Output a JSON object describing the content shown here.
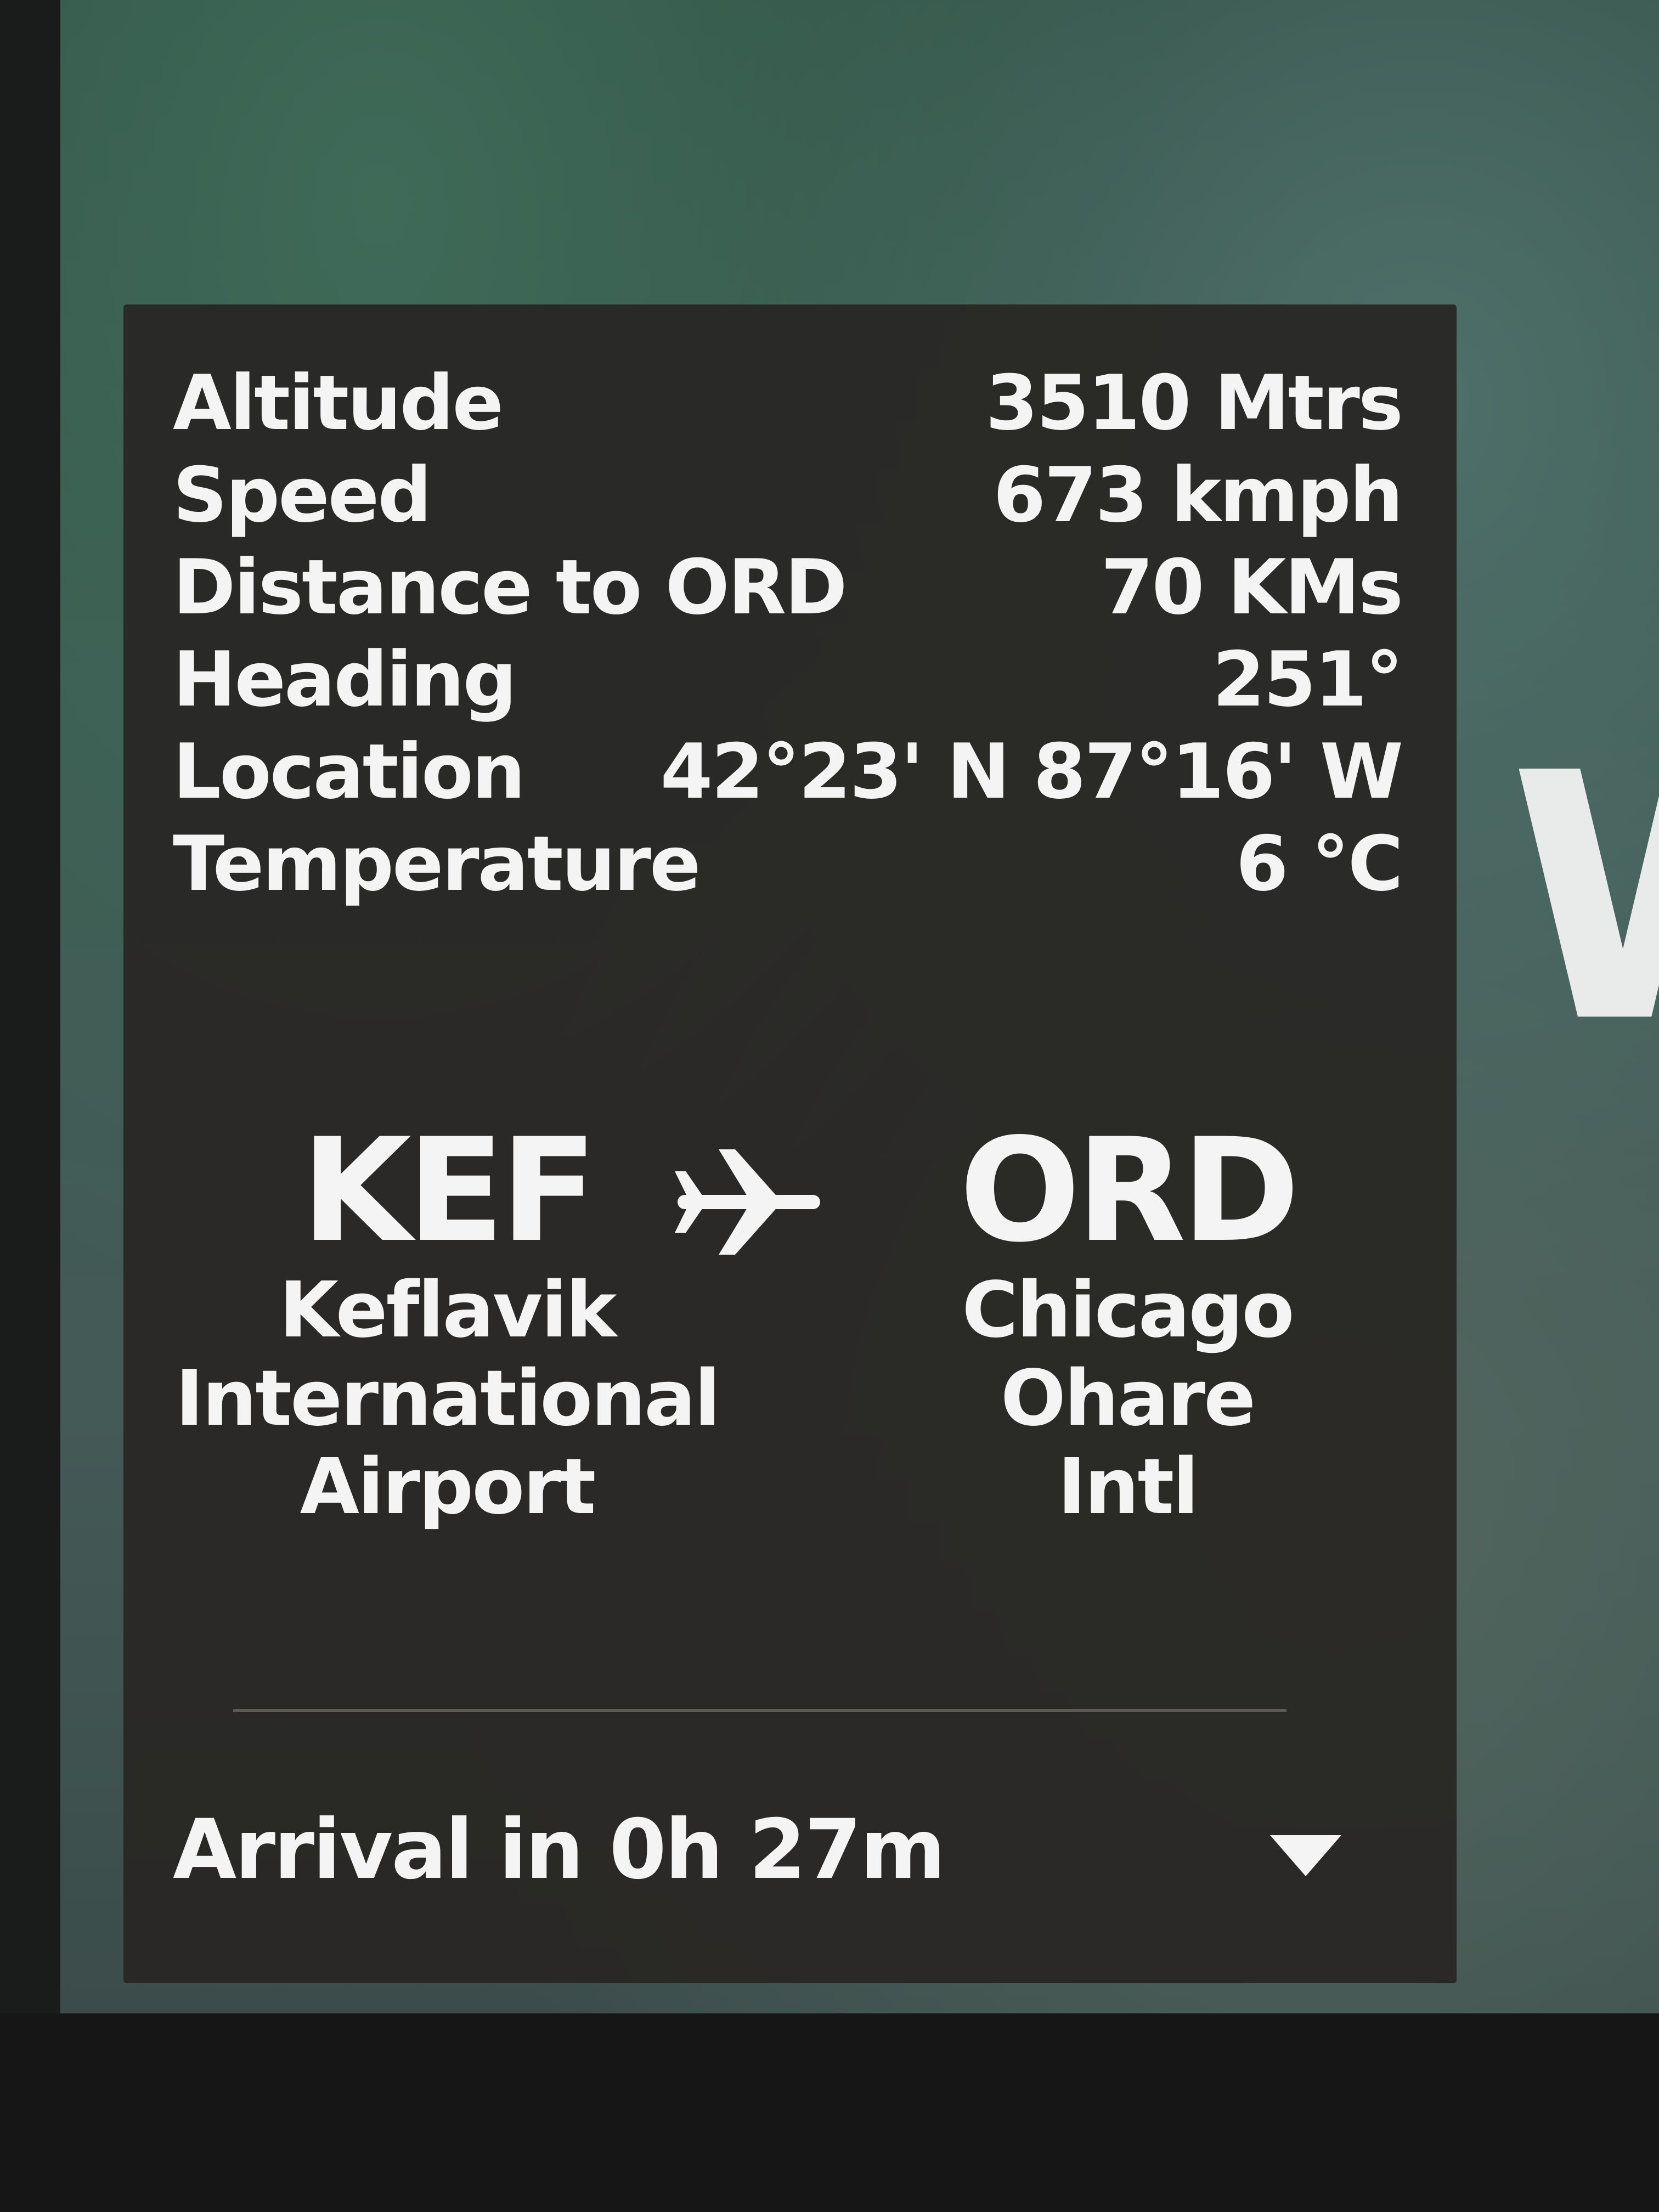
{
  "stats": {
    "altitude": {
      "label": "Altitude",
      "value": "3510 Mtrs"
    },
    "speed": {
      "label": "Speed",
      "value": "673 kmph"
    },
    "distance": {
      "label": "Distance to ORD",
      "value": "70 KMs"
    },
    "heading": {
      "label": "Heading",
      "value": "251°"
    },
    "location": {
      "label": "Location",
      "value": "42°23' N 87°16' W"
    },
    "temperature": {
      "label": "Temperature",
      "value": "6 °C"
    }
  },
  "route": {
    "origin": {
      "code": "KEF",
      "name_lines": [
        "Keflavik",
        "International",
        "Airport"
      ]
    },
    "destination": {
      "code": "ORD",
      "name_lines": [
        "Chicago Ohare",
        "Intl"
      ]
    }
  },
  "footer": {
    "arrival_text": "Arrival in 0h 27m"
  },
  "background": {
    "partial_word": "W"
  },
  "icons": {
    "route": "airplane-icon",
    "expand": "chevron-down-icon"
  },
  "colors": {
    "panel": "#282624",
    "text": "#f4f4f4"
  }
}
